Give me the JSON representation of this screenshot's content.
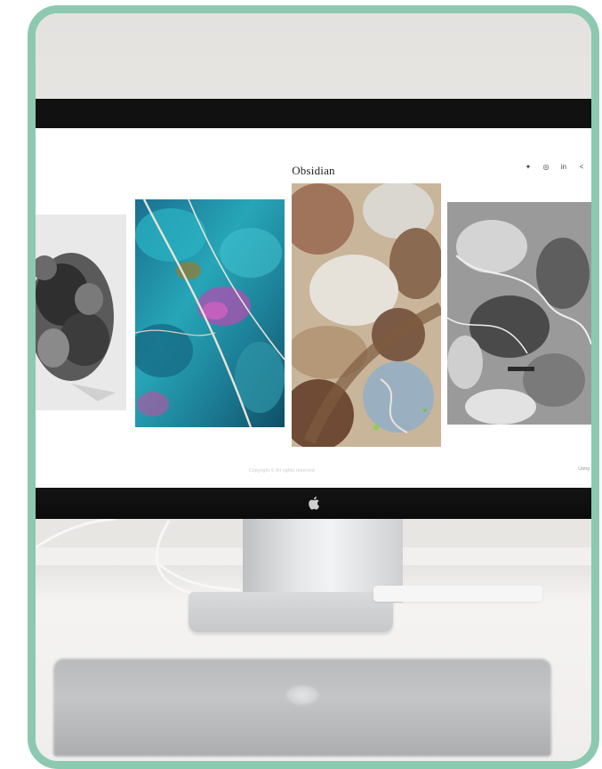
{
  "site": {
    "title": "Obsidian",
    "social_icons": [
      "twitter-icon",
      "instagram-icon",
      "linkedin-icon",
      "share-icon"
    ],
    "social_glyphs": [
      "✦",
      "◎",
      "in",
      "<"
    ],
    "footer_copyright": "Copyright © All rights reserved",
    "footer_right": "Using"
  },
  "colors": {
    "frame_border": "#8cc9b0",
    "monitor_bezel": "#111111",
    "screen_bg": "#ffffff"
  }
}
